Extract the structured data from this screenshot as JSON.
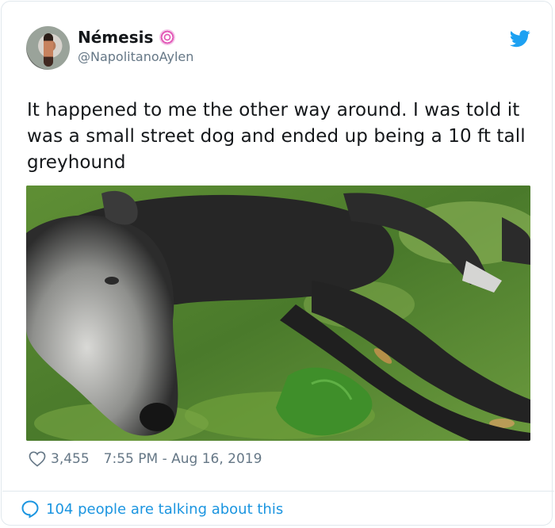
{
  "user": {
    "display_name": "Némesis",
    "handle": "@NapolitanoAylen",
    "avatar_icon": "profile-photo",
    "badge_icon": "pink-swirl-icon"
  },
  "tweet": {
    "text": "It happened to me the other way around. I was told it was a small street dog and ended up being a 10 ft tall greyhound",
    "photo_description": "black greyhound lying on grass"
  },
  "meta": {
    "likes": "3,455",
    "timestamp": "7:55 PM - Aug 16, 2019"
  },
  "footer": {
    "talking": "104 people are talking about this"
  },
  "colors": {
    "accent": "#1b95e0",
    "twitter_blue": "#1da1f2",
    "muted": "#657786",
    "border": "#e1e8ed"
  }
}
